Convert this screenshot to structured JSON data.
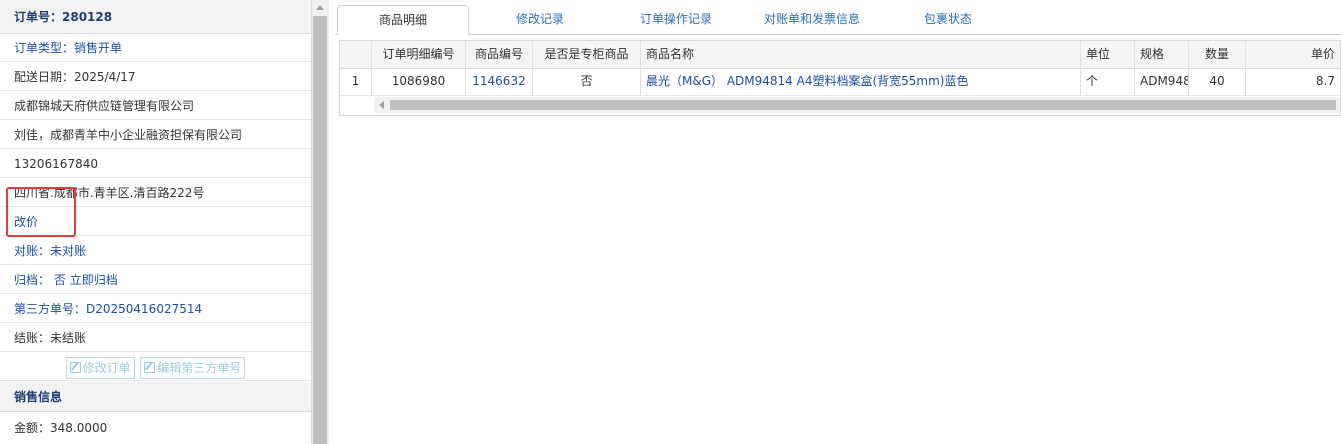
{
  "order": {
    "title": "订单号：280128",
    "type": "订单类型：销售开单",
    "delivery_date": "配送日期：2025/4/17",
    "company": "成都锦城天府供应链管理有限公司",
    "contact": "刘佳，成都青羊中小企业融资担保有限公司",
    "phone": "13206167840",
    "address": "四川省.成都市.青羊区.清百路222号",
    "change_price": "改价",
    "reconcile": "对账：未对账",
    "archive_label": "归档：",
    "archive_value": "否",
    "archive_link": "立即归档",
    "third_party": "第三方单号：D20250416027514",
    "settlement": "结账：未结账",
    "btn_edit_order": "修改订单",
    "btn_edit_third": "编辑第三方单号"
  },
  "sales": {
    "title": "销售信息",
    "amount": "金额：348.0000"
  },
  "tabs": [
    "商品明细",
    "修改记录",
    "订单操作记录",
    "对账单和发票信息",
    "包裹状态"
  ],
  "grid": {
    "headers": [
      "",
      "订单明细编号",
      "商品编号",
      "是否是专柜商品",
      "商品名称",
      "单位",
      "规格",
      "数量",
      "单价"
    ],
    "rows": [
      [
        "1",
        "1086980",
        "1146632",
        "否",
        "晨光（M&G） ADM94814 A4塑料档案盒(背宽55mm)蓝色",
        "个",
        "ADM948",
        "40",
        "8.7"
      ]
    ]
  },
  "colors": {
    "link": "#1d4fa3",
    "tab": "#2a6fb5",
    "highlight": "#e23b3b"
  }
}
